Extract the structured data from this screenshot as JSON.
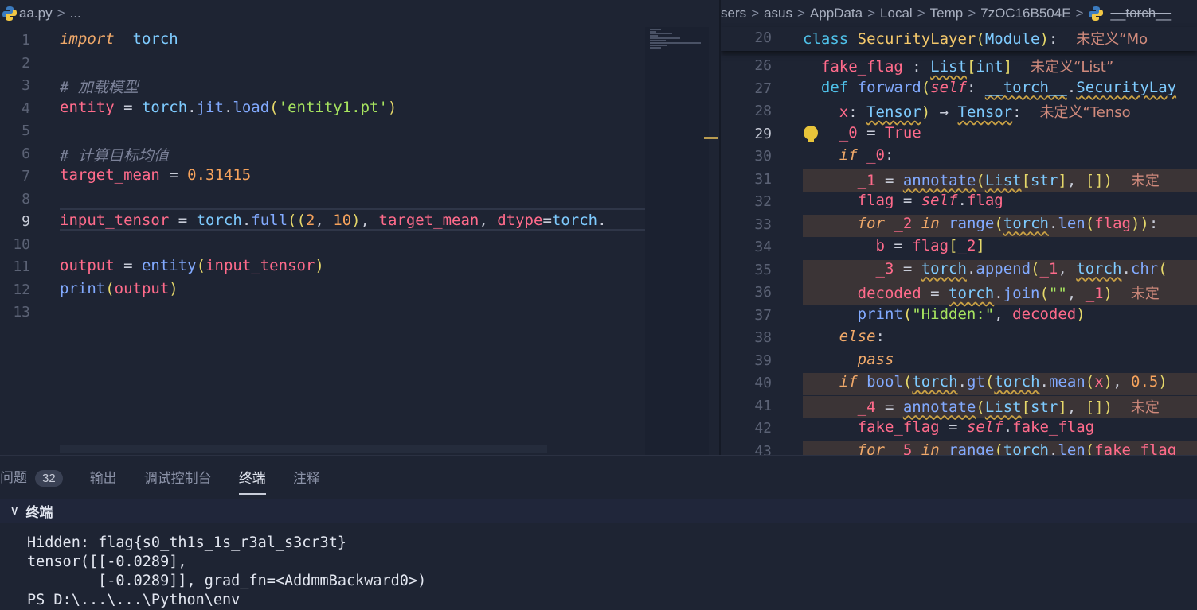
{
  "left_editor": {
    "breadcrumb": {
      "file": "aa.py",
      "sep": ">",
      "rest": "..."
    },
    "current_line": "9",
    "lines": [
      {
        "n": "1",
        "tokens": [
          [
            "kw",
            "import"
          ],
          [
            "",
            "  "
          ],
          [
            "mod",
            "torch"
          ]
        ]
      },
      {
        "n": "2",
        "tokens": []
      },
      {
        "n": "3",
        "tokens": [
          [
            "com",
            "# 加载模型"
          ]
        ]
      },
      {
        "n": "4",
        "tokens": [
          [
            "var",
            "entity"
          ],
          [
            "",
            " = "
          ],
          [
            "mod",
            "torch"
          ],
          [
            "",
            "."
          ],
          [
            "fn",
            "jit"
          ],
          [
            "",
            "."
          ],
          [
            "fn",
            "load"
          ],
          [
            "punc",
            "("
          ],
          [
            "str",
            "'entity1.pt'"
          ],
          [
            "punc",
            ")"
          ]
        ]
      },
      {
        "n": "5",
        "tokens": []
      },
      {
        "n": "6",
        "tokens": [
          [
            "com",
            "# 计算目标均值"
          ]
        ]
      },
      {
        "n": "7",
        "tokens": [
          [
            "var",
            "target_mean"
          ],
          [
            "",
            " = "
          ],
          [
            "num",
            "0.31415"
          ]
        ]
      },
      {
        "n": "8",
        "tokens": []
      },
      {
        "n": "9",
        "tokens": [
          [
            "var",
            "input_tensor"
          ],
          [
            "",
            " = "
          ],
          [
            "mod",
            "torch"
          ],
          [
            "",
            "."
          ],
          [
            "fn",
            "full"
          ],
          [
            "punc",
            "(("
          ],
          [
            "num",
            "2"
          ],
          [
            "",
            ", "
          ],
          [
            "num",
            "10"
          ],
          [
            "punc",
            ")"
          ],
          [
            "",
            ", "
          ],
          [
            "var",
            "target_mean"
          ],
          [
            "",
            ", "
          ],
          [
            "var",
            "dtype"
          ],
          [
            "",
            "="
          ],
          [
            "mod",
            "torch"
          ],
          [
            "",
            "."
          ]
        ]
      },
      {
        "n": "10",
        "tokens": []
      },
      {
        "n": "11",
        "tokens": [
          [
            "var",
            "output"
          ],
          [
            "",
            " = "
          ],
          [
            "fn",
            "entity"
          ],
          [
            "punc",
            "("
          ],
          [
            "var",
            "input_tensor"
          ],
          [
            "punc",
            ")"
          ]
        ]
      },
      {
        "n": "12",
        "tokens": [
          [
            "fn",
            "print"
          ],
          [
            "punc",
            "("
          ],
          [
            "var",
            "output"
          ],
          [
            "punc",
            ")"
          ]
        ]
      },
      {
        "n": "13",
        "tokens": []
      }
    ]
  },
  "right_editor": {
    "breadcrumb": {
      "segments": [
        "sers",
        "asus",
        "AppData",
        "Local",
        "Temp",
        "7zOC16B504E"
      ],
      "sep": ">",
      "last": "__torch__"
    },
    "sticky": {
      "n": "20",
      "tokens": [
        [
          "kw2",
          "class "
        ],
        [
          "cls",
          "SecurityLayer"
        ],
        [
          "punc",
          "("
        ],
        [
          "typ",
          "Module"
        ],
        [
          "punc",
          ")"
        ],
        [
          "",
          ":"
        ],
        [
          "hint",
          "    未定义“Mo"
        ]
      ]
    },
    "current_line": "29",
    "lines": [
      {
        "n": "26",
        "hl": false,
        "tokens": [
          [
            "",
            "  "
          ],
          [
            "var",
            "fake_flag"
          ],
          [
            "",
            " : "
          ],
          [
            "typ sq",
            "List"
          ],
          [
            "punc",
            "["
          ],
          [
            "typ",
            "int"
          ],
          [
            "punc",
            "]"
          ],
          [
            "hint",
            "    未定义“List”"
          ]
        ]
      },
      {
        "n": "27",
        "hl": false,
        "tokens": [
          [
            "",
            "  "
          ],
          [
            "kw2",
            "def "
          ],
          [
            "fn",
            "forward"
          ],
          [
            "punc",
            "("
          ],
          [
            "self",
            "self"
          ],
          [
            "",
            ": "
          ],
          [
            "typ sq",
            "__torch__"
          ],
          [
            "",
            "."
          ],
          [
            "typ sq",
            "SecurityLay"
          ]
        ]
      },
      {
        "n": "28",
        "hl": false,
        "tokens": [
          [
            "",
            "    "
          ],
          [
            "var",
            "x"
          ],
          [
            "",
            ": "
          ],
          [
            "typ sq",
            "Tensor"
          ],
          [
            "punc",
            ")"
          ],
          [
            "",
            " → "
          ],
          [
            "typ sq",
            "Tensor"
          ],
          [
            "",
            ":"
          ],
          [
            "hint",
            "    未定义“Tenso"
          ]
        ]
      },
      {
        "n": "29",
        "hl": false,
        "tokens": [
          [
            "",
            "    "
          ],
          [
            "var",
            "_0"
          ],
          [
            "",
            " = "
          ],
          [
            "var",
            "True"
          ]
        ]
      },
      {
        "n": "30",
        "hl": false,
        "tokens": [
          [
            "",
            "    "
          ],
          [
            "kw",
            "if"
          ],
          [
            "",
            " "
          ],
          [
            "var",
            "_0"
          ],
          [
            "",
            ":"
          ]
        ]
      },
      {
        "n": "31",
        "hl": true,
        "tokens": [
          [
            "",
            "      "
          ],
          [
            "var",
            "_1"
          ],
          [
            "",
            " = "
          ],
          [
            "fn sq",
            "annotate"
          ],
          [
            "punc",
            "("
          ],
          [
            "typ sq",
            "List"
          ],
          [
            "punc",
            "["
          ],
          [
            "typ",
            "str"
          ],
          [
            "punc",
            "]"
          ],
          [
            "",
            ", "
          ],
          [
            "punc",
            "[])"
          ],
          [
            "hint",
            "    未定"
          ]
        ]
      },
      {
        "n": "32",
        "hl": false,
        "tokens": [
          [
            "",
            "      "
          ],
          [
            "var",
            "flag"
          ],
          [
            "",
            " = "
          ],
          [
            "self",
            "self"
          ],
          [
            "",
            "."
          ],
          [
            "var",
            "flag"
          ]
        ]
      },
      {
        "n": "33",
        "hl": true,
        "tokens": [
          [
            "",
            "      "
          ],
          [
            "kw",
            "for"
          ],
          [
            "",
            " "
          ],
          [
            "var",
            "_2"
          ],
          [
            "",
            " "
          ],
          [
            "kw",
            "in"
          ],
          [
            "",
            " "
          ],
          [
            "fn",
            "range"
          ],
          [
            "punc",
            "("
          ],
          [
            "mod sq",
            "torch"
          ],
          [
            "",
            "."
          ],
          [
            "fn",
            "len"
          ],
          [
            "punc",
            "("
          ],
          [
            "var",
            "flag"
          ],
          [
            "punc",
            "))"
          ],
          [
            "",
            ":"
          ]
        ]
      },
      {
        "n": "34",
        "hl": false,
        "tokens": [
          [
            "",
            "        "
          ],
          [
            "var",
            "b"
          ],
          [
            "",
            " = "
          ],
          [
            "var",
            "flag"
          ],
          [
            "punc",
            "["
          ],
          [
            "var",
            "_2"
          ],
          [
            "punc",
            "]"
          ]
        ]
      },
      {
        "n": "35",
        "hl": true,
        "tokens": [
          [
            "",
            "        "
          ],
          [
            "var",
            "_3"
          ],
          [
            "",
            " = "
          ],
          [
            "mod sq",
            "torch"
          ],
          [
            "",
            "."
          ],
          [
            "fn",
            "append"
          ],
          [
            "punc",
            "("
          ],
          [
            "var",
            "_1"
          ],
          [
            "",
            ", "
          ],
          [
            "mod sq",
            "torch"
          ],
          [
            "",
            "."
          ],
          [
            "fn",
            "chr"
          ],
          [
            "punc",
            "("
          ]
        ]
      },
      {
        "n": "36",
        "hl": true,
        "tokens": [
          [
            "",
            "      "
          ],
          [
            "var",
            "decoded"
          ],
          [
            "",
            " = "
          ],
          [
            "mod sq",
            "torch"
          ],
          [
            "",
            "."
          ],
          [
            "fn",
            "join"
          ],
          [
            "punc",
            "("
          ],
          [
            "str",
            "\"\""
          ],
          [
            "",
            ", "
          ],
          [
            "var",
            "_1"
          ],
          [
            "punc",
            ")"
          ],
          [
            "hint",
            "    未定"
          ]
        ]
      },
      {
        "n": "37",
        "hl": false,
        "tokens": [
          [
            "",
            "      "
          ],
          [
            "fn",
            "print"
          ],
          [
            "punc",
            "("
          ],
          [
            "str",
            "\"Hidden:\""
          ],
          [
            "",
            ", "
          ],
          [
            "var",
            "decoded"
          ],
          [
            "punc",
            ")"
          ]
        ]
      },
      {
        "n": "38",
        "hl": false,
        "tokens": [
          [
            "",
            "    "
          ],
          [
            "kw",
            "else"
          ],
          [
            "",
            ":"
          ]
        ]
      },
      {
        "n": "39",
        "hl": false,
        "tokens": [
          [
            "",
            "      "
          ],
          [
            "kw",
            "pass"
          ]
        ]
      },
      {
        "n": "40",
        "hl": true,
        "tokens": [
          [
            "",
            "    "
          ],
          [
            "kw",
            "if"
          ],
          [
            "",
            " "
          ],
          [
            "fn",
            "bool"
          ],
          [
            "punc",
            "("
          ],
          [
            "mod sq",
            "torch"
          ],
          [
            "",
            "."
          ],
          [
            "fn",
            "gt"
          ],
          [
            "punc",
            "("
          ],
          [
            "mod sq",
            "torch"
          ],
          [
            "",
            "."
          ],
          [
            "fn",
            "mean"
          ],
          [
            "punc",
            "("
          ],
          [
            "var",
            "x"
          ],
          [
            "punc",
            ")"
          ],
          [
            "",
            ", "
          ],
          [
            "num",
            "0.5"
          ],
          [
            "punc",
            ")"
          ]
        ]
      },
      {
        "n": "41",
        "hl": true,
        "tokens": [
          [
            "",
            "      "
          ],
          [
            "var",
            "_4"
          ],
          [
            "",
            " = "
          ],
          [
            "fn sq",
            "annotate"
          ],
          [
            "punc",
            "("
          ],
          [
            "typ sq",
            "List"
          ],
          [
            "punc",
            "["
          ],
          [
            "typ",
            "str"
          ],
          [
            "punc",
            "]"
          ],
          [
            "",
            ", "
          ],
          [
            "punc",
            "[])"
          ],
          [
            "hint",
            "    未定"
          ]
        ]
      },
      {
        "n": "42",
        "hl": false,
        "tokens": [
          [
            "",
            "      "
          ],
          [
            "var",
            "fake_flag"
          ],
          [
            "",
            " = "
          ],
          [
            "self",
            "self"
          ],
          [
            "",
            "."
          ],
          [
            "var",
            "fake_flag"
          ]
        ]
      },
      {
        "n": "43",
        "hl": true,
        "tokens": [
          [
            "",
            "      "
          ],
          [
            "kw",
            "for"
          ],
          [
            "",
            " "
          ],
          [
            "var",
            "_5"
          ],
          [
            "",
            " "
          ],
          [
            "kw",
            "in"
          ],
          [
            "",
            " "
          ],
          [
            "fn",
            "range"
          ],
          [
            "punc",
            "("
          ],
          [
            "mod",
            "torch"
          ],
          [
            "",
            "."
          ],
          [
            "fn",
            "len"
          ],
          [
            "punc",
            "("
          ],
          [
            "var",
            "fake_flag"
          ]
        ]
      }
    ]
  },
  "panel": {
    "tabs": [
      {
        "label": "问题",
        "badge": "32"
      },
      {
        "label": "输出"
      },
      {
        "label": "调试控制台"
      },
      {
        "label": "终端",
        "active": true
      },
      {
        "label": "注释"
      }
    ],
    "terminal_title": "终端",
    "terminal_lines": [
      "Hidden: flag{s0_th1s_1s_r3al_s3cr3t}",
      "tensor([[-0.0289],",
      "        [-0.0289]], grad_fn=<AddmmBackward0>)",
      "PS D:\\...\\...\\Python\\env"
    ]
  }
}
